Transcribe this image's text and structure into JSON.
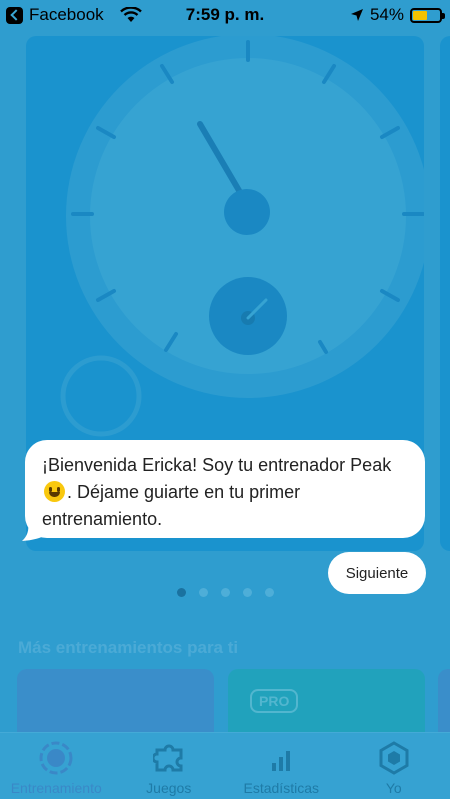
{
  "status_bar": {
    "back_app": "Facebook",
    "time": "7:59 p. m.",
    "battery_percent": "54%",
    "battery_level": 0.54,
    "icons": [
      "back-icon",
      "wifi-icon",
      "location-arrow-icon",
      "battery-icon"
    ]
  },
  "hero": {
    "illustration": "speedometer-gauge",
    "colors": {
      "card": "#0f8fce",
      "dial": "#3aa6d3",
      "accent": "#0e7fbd"
    }
  },
  "coach": {
    "message_part1": "¡Bienvenida Ericka! Soy tu entrenador Peak",
    "emoji": "grinning-face",
    "message_part2": ". Déjame guiarte en tu primer entrenamiento.",
    "next_label": "Siguiente"
  },
  "carousel": {
    "page_count": 5,
    "active_index": 0
  },
  "more_section": {
    "title": "Más entrenamientos para ti",
    "cards": [
      {
        "badge": ""
      },
      {
        "badge": "PRO"
      }
    ]
  },
  "tabbar": {
    "items": [
      {
        "label": "Entrenamiento",
        "icon": "training-target-icon",
        "active": true
      },
      {
        "label": "Juegos",
        "icon": "puzzle-piece-icon",
        "active": false
      },
      {
        "label": "Estadísticas",
        "icon": "bar-chart-icon",
        "active": false
      },
      {
        "label": "Yo",
        "icon": "hexagon-profile-icon",
        "active": false
      }
    ]
  }
}
